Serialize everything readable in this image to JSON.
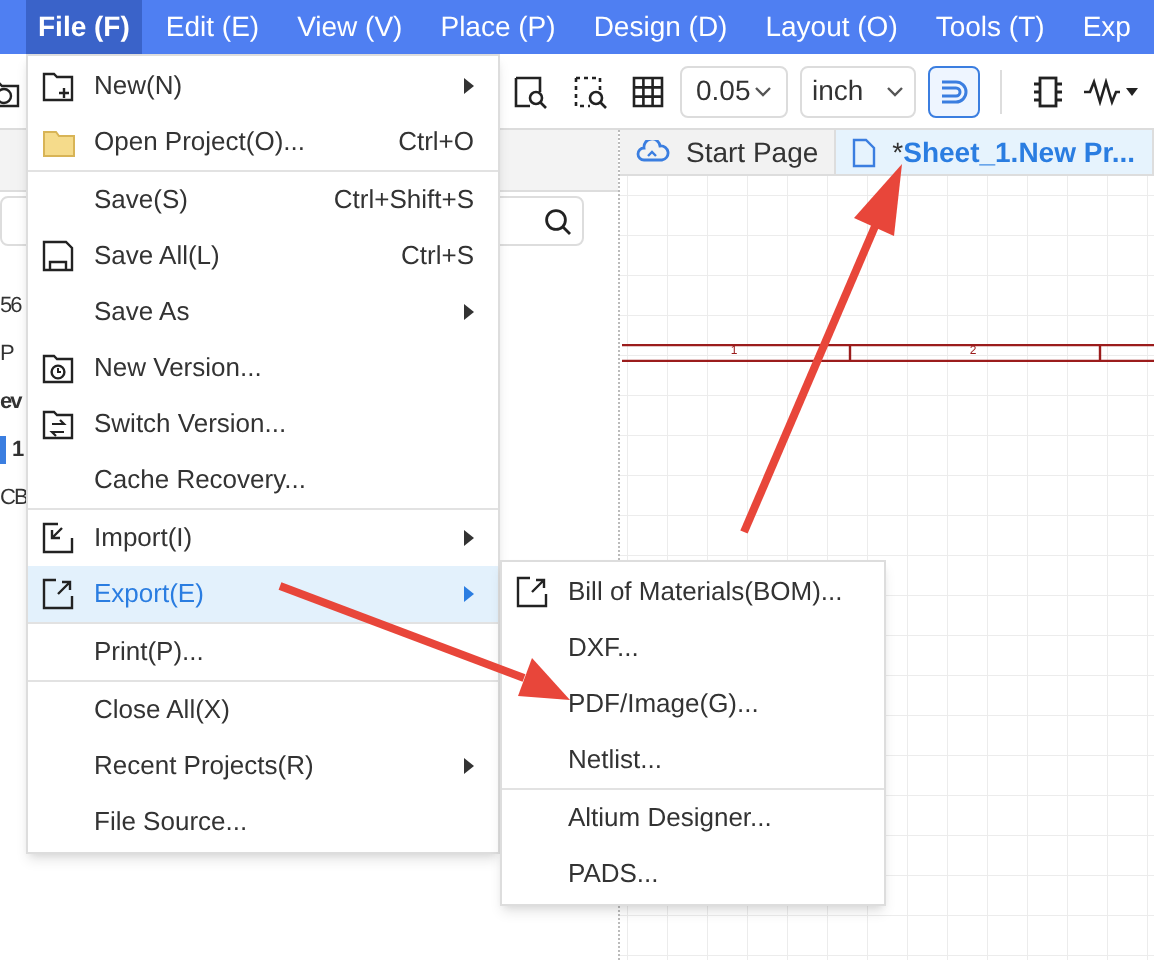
{
  "menubar": [
    {
      "label": "File (F)",
      "selected": true
    },
    {
      "label": "Edit (E)",
      "selected": false
    },
    {
      "label": "View (V)",
      "selected": false
    },
    {
      "label": "Place (P)",
      "selected": false
    },
    {
      "label": "Design (D)",
      "selected": false
    },
    {
      "label": "Layout (O)",
      "selected": false
    },
    {
      "label": "Tools (T)",
      "selected": false
    },
    {
      "label": "Exp",
      "selected": false
    }
  ],
  "toolbar": {
    "grid_size": "0.05",
    "unit": "inch",
    "snap_on": true
  },
  "left_panel": {
    "lines": [
      {
        "text": "56",
        "bold": false,
        "marked": false
      },
      {
        "text": "P",
        "bold": false,
        "marked": false
      },
      {
        "text": "ev",
        "bold": true,
        "marked": false
      },
      {
        "text": "1",
        "bold": true,
        "marked": true
      },
      {
        "text": "CB",
        "bold": false,
        "marked": false
      }
    ]
  },
  "tabs": [
    {
      "kind": "start",
      "label": "Start Page",
      "selected": false
    },
    {
      "kind": "sheet",
      "prefix": "*",
      "label": "Sheet_1.New Pr...",
      "selected": true
    }
  ],
  "sheet": {
    "zones": [
      "1",
      "2"
    ]
  },
  "file_menu": [
    [
      {
        "kind": "new",
        "label": "New(N)",
        "submenu": true,
        "selected": false
      },
      {
        "kind": "folder",
        "label": "Open Project(O)...",
        "shortcut": "Ctrl+O",
        "submenu": false,
        "selected": false
      }
    ],
    [
      {
        "label": "Save(S)",
        "shortcut": "Ctrl+Shift+S",
        "submenu": false,
        "selected": false
      },
      {
        "kind": "save",
        "label": "Save All(L)",
        "shortcut": "Ctrl+S",
        "submenu": false,
        "selected": false
      },
      {
        "label": "Save As",
        "submenu": true,
        "selected": false
      },
      {
        "kind": "new_version",
        "label": "New Version...",
        "submenu": false,
        "selected": false
      },
      {
        "kind": "switch_version",
        "label": "Switch Version...",
        "submenu": false,
        "selected": false
      },
      {
        "label": "Cache Recovery...",
        "submenu": false,
        "selected": false
      }
    ],
    [
      {
        "kind": "import",
        "label": "Import(I)",
        "submenu": true,
        "selected": false
      },
      {
        "kind": "export",
        "label": "Export(E)",
        "submenu": true,
        "selected": true
      }
    ],
    [
      {
        "label": "Print(P)...",
        "submenu": false,
        "selected": false
      }
    ],
    [
      {
        "label": "Close All(X)",
        "submenu": false,
        "selected": false
      },
      {
        "label": "Recent Projects(R)",
        "submenu": true,
        "selected": false
      },
      {
        "label": "File Source...",
        "submenu": false,
        "selected": false
      }
    ]
  ],
  "export_menu": [
    [
      {
        "kind": "export",
        "label": "Bill of Materials(BOM)..."
      },
      {
        "label": "DXF..."
      },
      {
        "label": "PDF/Image(G)..."
      },
      {
        "label": "Netlist..."
      }
    ],
    [
      {
        "label": "Altium Designer..."
      },
      {
        "label": "PADS..."
      }
    ]
  ]
}
